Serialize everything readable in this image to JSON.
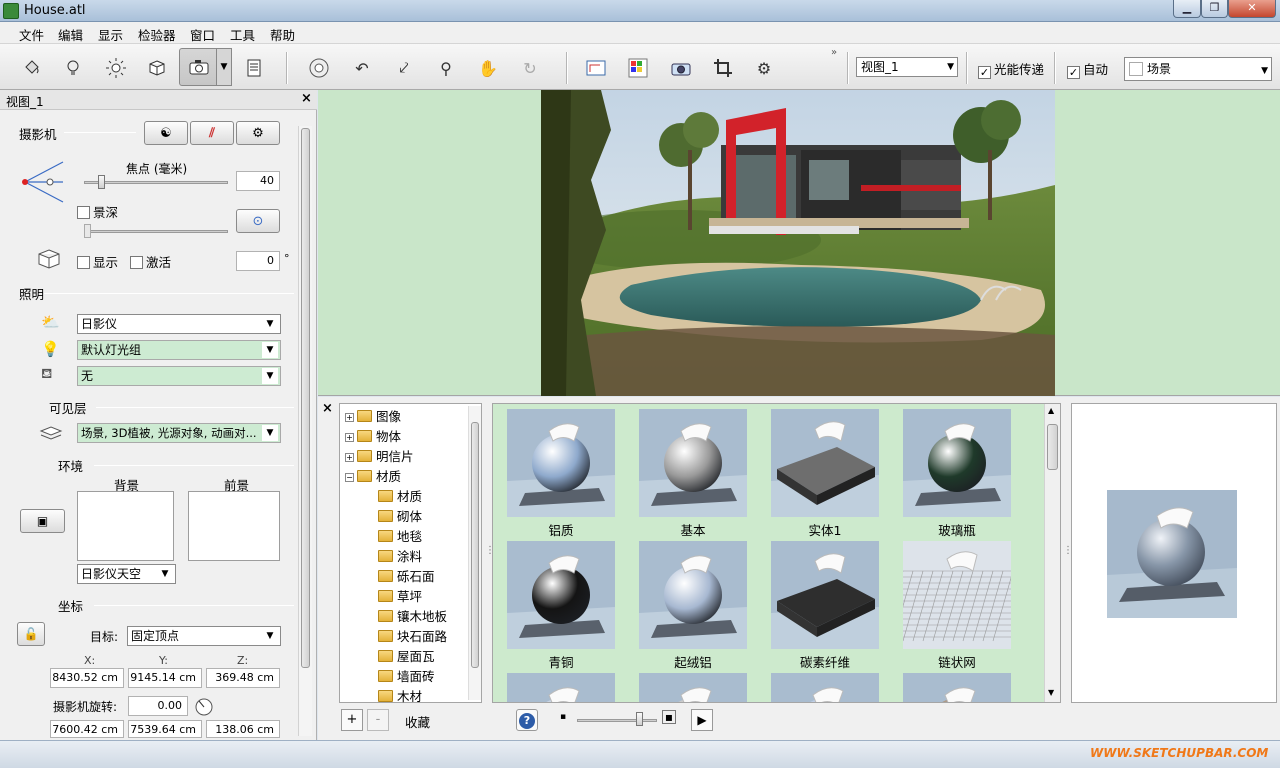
{
  "window": {
    "title": "House.atl"
  },
  "menu": [
    "文件",
    "编辑",
    "显示",
    "检验器",
    "窗口",
    "工具",
    "帮助"
  ],
  "toolbar": {
    "view_select": "视图_1",
    "light_transport_label": "光能传递",
    "light_transport_checked": true,
    "auto_label": "自动",
    "auto_checked": true,
    "scene_select": "场景",
    "overflow": "»"
  },
  "left_panel": {
    "header": "视图_1",
    "camera": {
      "title": "摄影机",
      "focal_label": "焦点 (毫米)",
      "focal_value": "40",
      "focal_slider": 0.12,
      "dof_label": "景深",
      "show_label": "显示",
      "activate_label": "激活",
      "angle_value": "0",
      "angle_unit": "°"
    },
    "lighting": {
      "title": "照明",
      "sun": "日影仪",
      "light_group": "默认灯光组",
      "extra": "无"
    },
    "layers": {
      "title": "可见层",
      "value": "场景, 3D植被, 光源对象, 动画对..."
    },
    "environment": {
      "title": "环境",
      "background_label": "背景",
      "foreground_label": "前景",
      "sky": "日影仪天空"
    },
    "coords": {
      "title": "坐标",
      "target_label": "目标:",
      "target_value": "固定顶点",
      "x_label": "X:",
      "y_label": "Y:",
      "z_label": "Z:",
      "x": "8430.52 cm",
      "y": "9145.14 cm",
      "z": "369.48 cm",
      "rotation_label": "摄影机旋转:",
      "rotation_value": "0.00",
      "pos2_x": "7600.42 cm",
      "pos2_y": "7539.64 cm",
      "pos2_z": "138.06 cm"
    }
  },
  "library": {
    "tree": [
      {
        "label": "图像",
        "level": 0,
        "exp": "+"
      },
      {
        "label": "物体",
        "level": 0,
        "exp": "+"
      },
      {
        "label": "明信片",
        "level": 0,
        "exp": "+"
      },
      {
        "label": "材质",
        "level": 0,
        "exp": "−"
      },
      {
        "label": "材质",
        "level": 1
      },
      {
        "label": "砌体",
        "level": 1
      },
      {
        "label": "地毯",
        "level": 1
      },
      {
        "label": "涂料",
        "level": 1
      },
      {
        "label": "砾石面",
        "level": 1
      },
      {
        "label": "草坪",
        "level": 1
      },
      {
        "label": "镶木地板",
        "level": 1
      },
      {
        "label": "块石面路",
        "level": 1
      },
      {
        "label": "屋面瓦",
        "level": 1
      },
      {
        "label": "墙面砖",
        "level": 1
      },
      {
        "label": "木材",
        "level": 1
      }
    ],
    "materials": [
      {
        "label": "铝质",
        "kind": "sphere",
        "color": "#8ea9cc"
      },
      {
        "label": "基本",
        "kind": "sphere",
        "color": "#9a9a9a"
      },
      {
        "label": "实体1",
        "kind": "slab",
        "color": "#6e6e6e"
      },
      {
        "label": "玻璃瓶",
        "kind": "sphere",
        "color": "#1f3a2a"
      },
      {
        "label": "青铜",
        "kind": "sphere",
        "color": "#141414"
      },
      {
        "label": "起绒铝",
        "kind": "sphere",
        "color": "#a7b8d1"
      },
      {
        "label": "碳素纤维",
        "kind": "slab",
        "color": "#2e2e2e"
      },
      {
        "label": "链状网",
        "kind": "mesh",
        "color": "#dcdcdc"
      },
      {
        "label": "",
        "kind": "sphere",
        "color": "#9fb3cf"
      },
      {
        "label": "",
        "kind": "sphere",
        "color": "#a2a2a2"
      },
      {
        "label": "",
        "kind": "sphere",
        "color": "#8aa6d0"
      },
      {
        "label": "",
        "kind": "sphere",
        "color": "#6b4a2a"
      }
    ],
    "favorites_label": "收藏",
    "zoom_slider": 0.78
  },
  "watermark": "WWW.SKETCHUPBAR.COM"
}
